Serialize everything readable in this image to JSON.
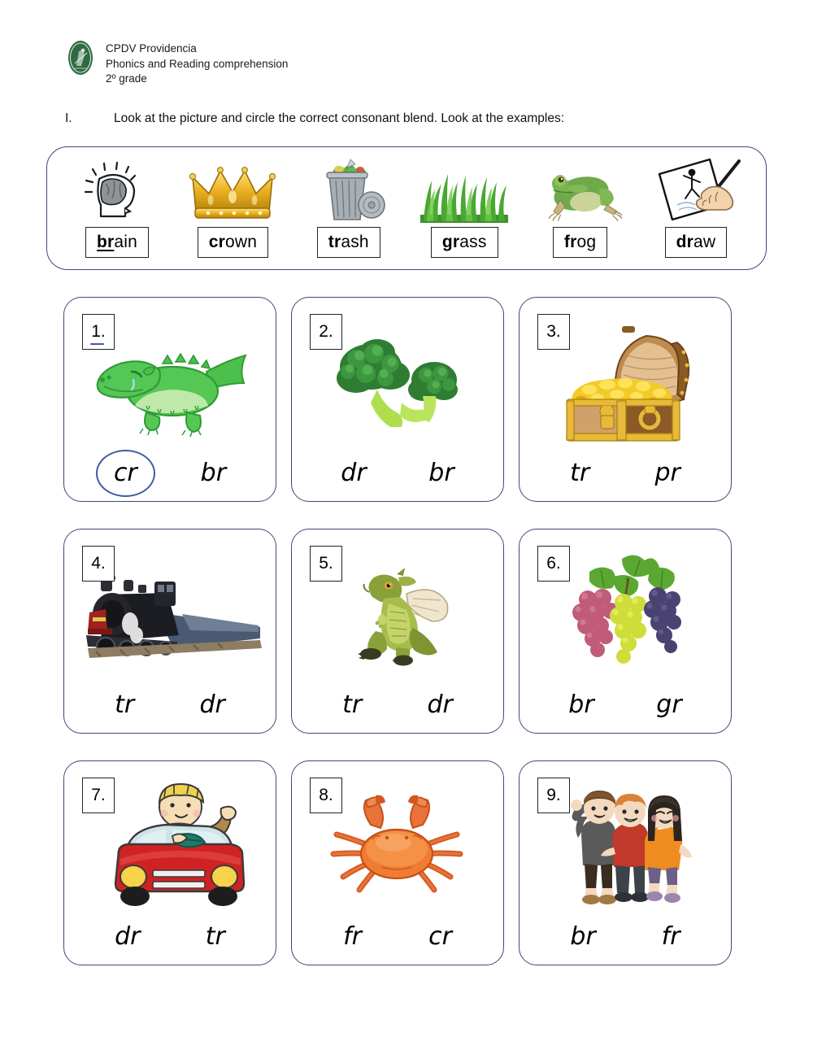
{
  "header": {
    "logo_icon": "school-crest-icon",
    "school": "CPDV Providencia",
    "subject": "Phonics and Reading comprehension",
    "grade": "2º grade"
  },
  "instruction": {
    "numeral": "I.",
    "text": "Look at the picture and circle the correct consonant blend. Look at the examples:"
  },
  "examples": [
    {
      "icon": "brain-head-icon",
      "blend": "br",
      "rest": "ain",
      "underlined": true
    },
    {
      "icon": "crown-icon",
      "blend": "cr",
      "rest": "own",
      "underlined": false
    },
    {
      "icon": "trash-can-icon",
      "blend": "tr",
      "rest": "ash",
      "underlined": false
    },
    {
      "icon": "grass-icon",
      "blend": "gr",
      "rest": "ass",
      "underlined": false
    },
    {
      "icon": "frog-icon",
      "blend": "fr",
      "rest": "og",
      "underlined": false
    },
    {
      "icon": "drawing-hand-icon",
      "blend": "dr",
      "rest": "aw",
      "underlined": false
    }
  ],
  "questions": [
    {
      "number": "1.",
      "icon": "crocodile-icon",
      "left": "cr",
      "right": "br",
      "circled": "left",
      "marked": true
    },
    {
      "number": "2.",
      "icon": "broccoli-icon",
      "left": "dr",
      "right": "br",
      "circled": "none",
      "marked": false
    },
    {
      "number": "3.",
      "icon": "treasure-icon",
      "left": "tr",
      "right": "pr",
      "circled": "none",
      "marked": false
    },
    {
      "number": "4.",
      "icon": "train-icon",
      "left": "tr",
      "right": "dr",
      "circled": "none",
      "marked": false
    },
    {
      "number": "5.",
      "icon": "dragon-icon",
      "left": "tr",
      "right": "dr",
      "circled": "none",
      "marked": false
    },
    {
      "number": "6.",
      "icon": "grapes-icon",
      "left": "br",
      "right": "gr",
      "circled": "none",
      "marked": false
    },
    {
      "number": "7.",
      "icon": "car-driver-icon",
      "left": "dr",
      "right": "tr",
      "circled": "none",
      "marked": false
    },
    {
      "number": "8.",
      "icon": "crab-icon",
      "left": "fr",
      "right": "cr",
      "circled": "none",
      "marked": false
    },
    {
      "number": "9.",
      "icon": "friends-icon",
      "left": "br",
      "right": "fr",
      "circled": "none",
      "marked": false
    }
  ],
  "colors": {
    "card_border": "#3b4a7a",
    "circle_mark": "#3f5ba0",
    "crest_green": "#2f6b42"
  }
}
